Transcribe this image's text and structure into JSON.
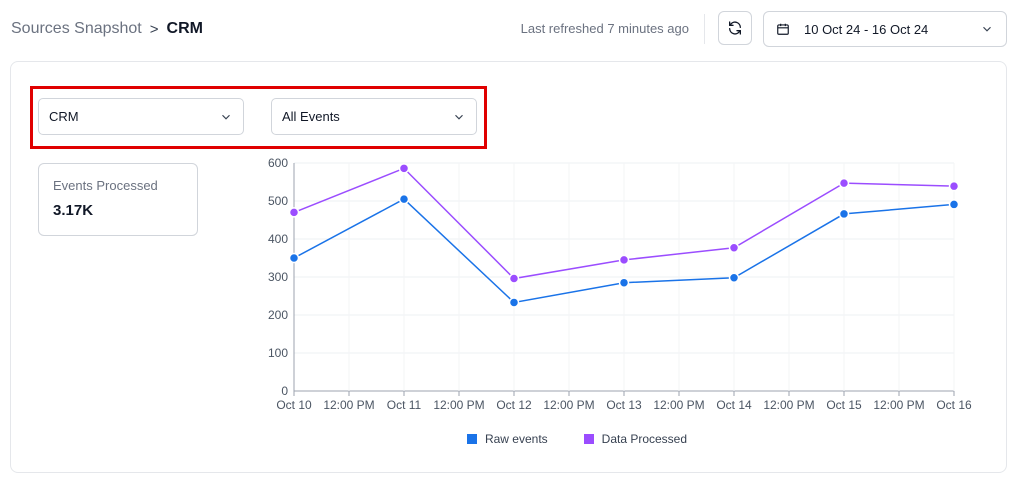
{
  "breadcrumb": {
    "parent": "Sources Snapshot",
    "separator": ">",
    "current": "CRM"
  },
  "header": {
    "last_refreshed": "Last refreshed 7 minutes ago",
    "date_range": "10 Oct 24 - 16 Oct 24"
  },
  "icons": {
    "refresh": "refresh-icon",
    "calendar": "calendar-icon",
    "chevron": "chevron-down-icon"
  },
  "filters": {
    "source": "CRM",
    "events": "All Events"
  },
  "stat": {
    "label": "Events Processed",
    "value": "3.17K"
  },
  "colors": {
    "raw": "#1a73e8",
    "processed": "#9b4dff",
    "highlight": "#e00000"
  },
  "chart_data": {
    "type": "line",
    "x": [
      "Oct 10",
      "12:00 PM",
      "Oct 11",
      "12:00 PM",
      "Oct 12",
      "12:00 PM",
      "Oct 13",
      "12:00 PM",
      "Oct 14",
      "12:00 PM",
      "Oct 15",
      "12:00 PM",
      "Oct 16"
    ],
    "point_categories": [
      "Oct 10",
      "Oct 11",
      "Oct 12",
      "Oct 13",
      "Oct 14",
      "Oct 15",
      "Oct 16"
    ],
    "series": [
      {
        "name": "Raw events",
        "color": "#1a73e8",
        "values": [
          350,
          505,
          233,
          285,
          298,
          466,
          491
        ]
      },
      {
        "name": "Data Processed",
        "color": "#9b4dff",
        "values": [
          470,
          586,
          296,
          345,
          377,
          547,
          539
        ]
      }
    ],
    "yticks": [
      "0",
      "100",
      "200",
      "300",
      "400",
      "500",
      "600"
    ],
    "ylim": [
      0,
      600
    ],
    "grid": true,
    "legend": "bottom-center"
  }
}
